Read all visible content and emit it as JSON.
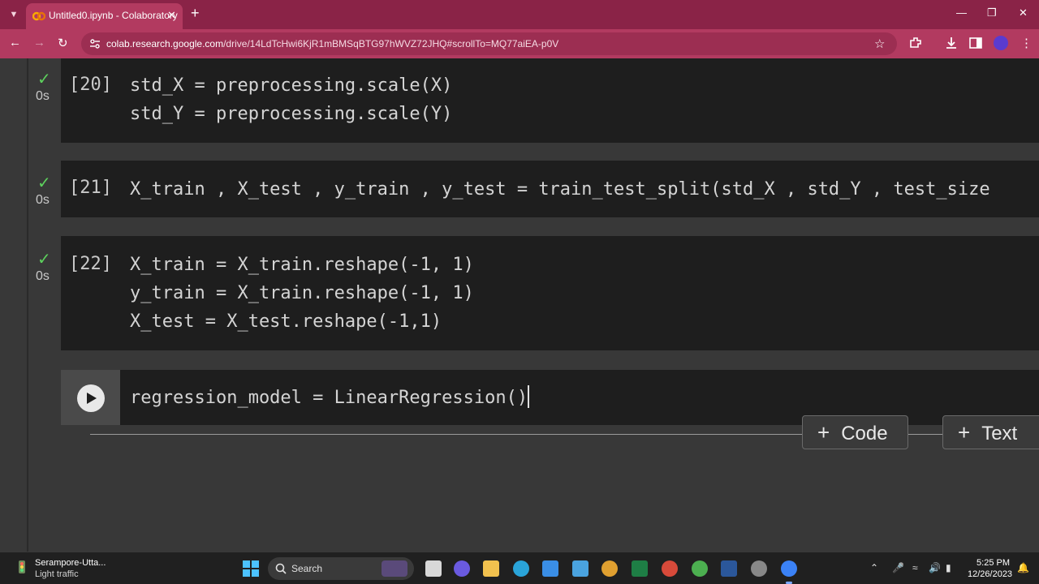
{
  "browser": {
    "tab_title": "Untitled0.ipynb - Colaboratory",
    "url_host": "colab.research.google.com",
    "url_path": "/drive/14LdTcHwi6KjR1mBMSqBTG97hWVZ72JHQ#scrollTo=MQ77aiEA-p0V",
    "accent_color": "#b23a60"
  },
  "cells": [
    {
      "exec": "[20]",
      "status": "0s",
      "lines": [
        "std_X = preprocessing.scale(X)",
        "std_Y = preprocessing.scale(Y)"
      ]
    },
    {
      "exec": "[21]",
      "status": "0s",
      "lines": [
        "X_train , X_test , y_train , y_test = train_test_split(std_X , std_Y , test_size"
      ]
    },
    {
      "exec": "[22]",
      "status": "0s",
      "lines": [
        "X_train = X_train.reshape(-1, 1)",
        "y_train = X_train.reshape(-1, 1)",
        "X_test = X_test.reshape(-1,1)"
      ]
    }
  ],
  "active_cell": {
    "code": "regression_model = LinearRegression()"
  },
  "toolbar": {
    "add_code": "Code",
    "add_text": "Text"
  },
  "taskbar": {
    "weather_location": "Serampore-Utta...",
    "weather_status": "Light traffic",
    "search_label": "Search",
    "time": "5:25 PM",
    "date": "12/26/2023"
  }
}
